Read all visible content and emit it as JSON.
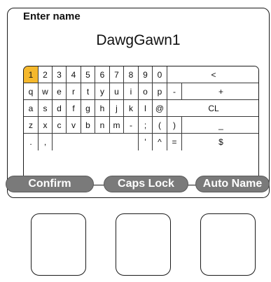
{
  "dialog": {
    "title": "Enter name",
    "name_value": "DawgGawn1"
  },
  "keyboard": {
    "selected_key": "1",
    "rows": [
      [
        "1",
        "2",
        "3",
        "4",
        "5",
        "6",
        "7",
        "8",
        "9",
        "0",
        "<"
      ],
      [
        "q",
        "w",
        "e",
        "r",
        "t",
        "y",
        "u",
        "i",
        "o",
        "p",
        "-",
        "+"
      ],
      [
        "a",
        "s",
        "d",
        "f",
        "g",
        "h",
        "j",
        "k",
        "l",
        "@",
        "CL"
      ],
      [
        "z",
        "x",
        "c",
        "v",
        "b",
        "n",
        "m",
        "-",
        ";",
        "(",
        ")",
        "_"
      ],
      [
        ".",
        ",",
        "",
        "'",
        "^",
        "=",
        "$"
      ]
    ]
  },
  "actions": {
    "confirm_label": "Confirm",
    "caps_lock_label": "Caps Lock",
    "auto_name_label": "Auto Name"
  },
  "colors": {
    "selected_key": "#f5b82c",
    "action_button": "#7a7a7a"
  }
}
